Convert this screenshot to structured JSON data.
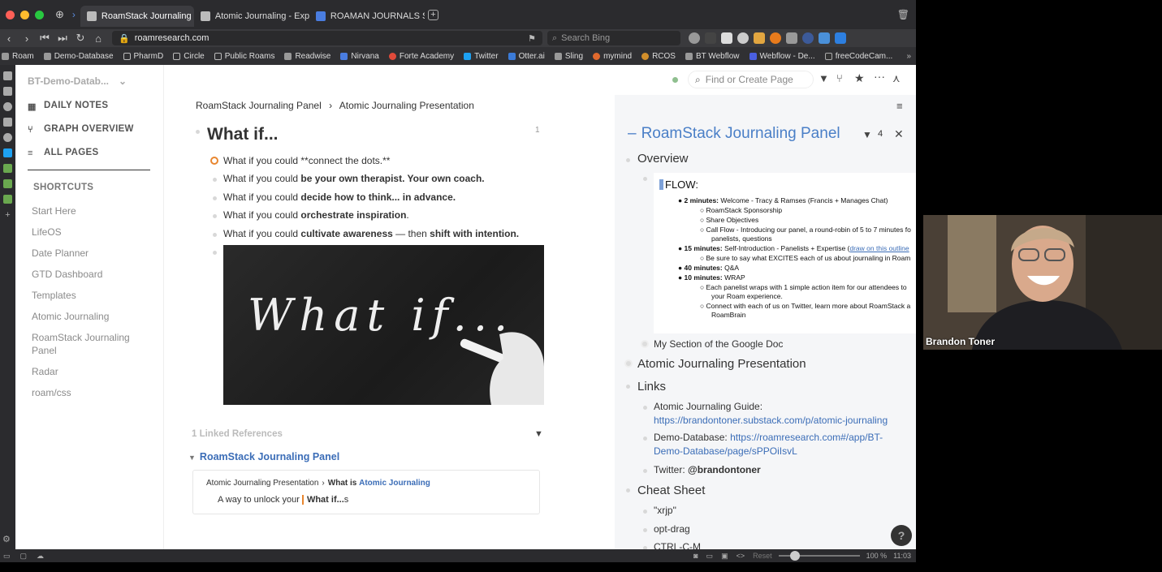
{
  "browser": {
    "tabs": [
      "RoamStack Journaling Pa",
      "Atomic Journaling - Expan",
      "ROAMAN JOURNALS SU"
    ],
    "url": "roamresearch.com",
    "search_placeholder": "Search Bing",
    "bookmarks": [
      "Roam",
      "Demo-Database",
      "PharmD",
      "Circle",
      "Public Roams",
      "Readwise",
      "Nirvana",
      "Forte Academy",
      "Twitter",
      "Otter.ai",
      "Sling",
      "mymind",
      "RCOS",
      "BT Webflow",
      "Webflow - De...",
      "freeCodeCam..."
    ],
    "zoom": "100 %",
    "time": "11:03",
    "reset": "Reset"
  },
  "sidebar": {
    "graph": "BT-Demo-Datab...",
    "nav": [
      "DAILY NOTES",
      "GRAPH OVERVIEW",
      "ALL PAGES"
    ],
    "shortcuts_title": "SHORTCUTS",
    "shortcuts": [
      "Start Here",
      "LifeOS",
      "Date Planner",
      "GTD Dashboard",
      "Templates",
      "Atomic Journaling",
      "RoamStack Journaling Panel",
      "Radar",
      "roam/css"
    ]
  },
  "topbar": {
    "find_placeholder": "Find or Create Page"
  },
  "main": {
    "breadcrumb": [
      "RoamStack Journaling Panel",
      "Atomic Journaling Presentation"
    ],
    "title": "What if...",
    "count": "1",
    "lines": [
      {
        "pre": "What if you could **connect the dots.**",
        "bold": ""
      },
      {
        "pre": "What if you could ",
        "bold": "be your own therapist. Your own coach."
      },
      {
        "pre": "What if you could ",
        "bold": "decide how to think... in advance."
      },
      {
        "pre": "What if you could ",
        "bold": "orchestrate inspiration",
        "post": "."
      },
      {
        "pre": "What if you could ",
        "bold": "cultivate awareness",
        "mid": " — then ",
        "bold2": "shift with intention."
      }
    ],
    "image_text": "What if...",
    "linked_refs": "1 Linked References",
    "ref_page": "RoamStack Journaling Panel",
    "ref_crumb1": "Atomic Journaling Presentation",
    "ref_crumb2_pre": "What is",
    "ref_crumb2_link": "Atomic Journaling",
    "ref_block_pre": "A way to unlock your",
    "ref_block_bold": "What if...",
    "ref_block_post": "s"
  },
  "right": {
    "title": "RoamStack Journaling Panel",
    "count": "4",
    "overview": "Overview",
    "flow_title": "FLOW:",
    "flow": [
      {
        "b": "2 minutes:",
        "t": " Welcome - Tracy & Ramses  (Francis + Manages Chat)"
      },
      {
        "sub": "RoamStack Sponsorship"
      },
      {
        "sub": "Share Objectives"
      },
      {
        "sub": "Call Flow - Introducing our panel, a round-robin of 5 to 7 minutes fo"
      },
      {
        "sub": "panelists, questions"
      },
      {
        "b": "15 minutes:",
        "t": " Self-Introduction - Panelists + Expertise (",
        "l": "draw on this outline"
      },
      {
        "sub": "Be sure to say what EXCITES each of us about journaling in Roam"
      },
      {
        "b": "40 minutes:",
        "t": " Q&A"
      },
      {
        "b": "10 minutes:",
        "t": " WRAP"
      },
      {
        "sub": "Each panelist wraps with 1 simple action item for our attendees to"
      },
      {
        "sub": "your Roam experience."
      },
      {
        "sub": "Connect with each of us on Twitter, learn more about RoamStack a"
      },
      {
        "sub": "RoamBrain"
      }
    ],
    "section_doc": "My Section of the Google Doc",
    "atomic": "Atomic Journaling Presentation",
    "links": "Links",
    "guide_label": "Atomic Journaling Guide:",
    "guide_url": "https://brandontoner.substack.com/p/atomic-journaling",
    "demo_label": "Demo-Database:",
    "demo_url1": "https://roamresearch.com#/app/BT-",
    "demo_url2": "Demo-Database/page/sPPOiIsvL",
    "twitter_label": "Twitter:",
    "twitter_handle": "@brandontoner",
    "cheat": "Cheat Sheet",
    "cheat_items": [
      "\"xrjp\"",
      "opt-drag",
      "CTRL-C-M"
    ]
  },
  "video": {
    "name": "Brandon Toner"
  }
}
